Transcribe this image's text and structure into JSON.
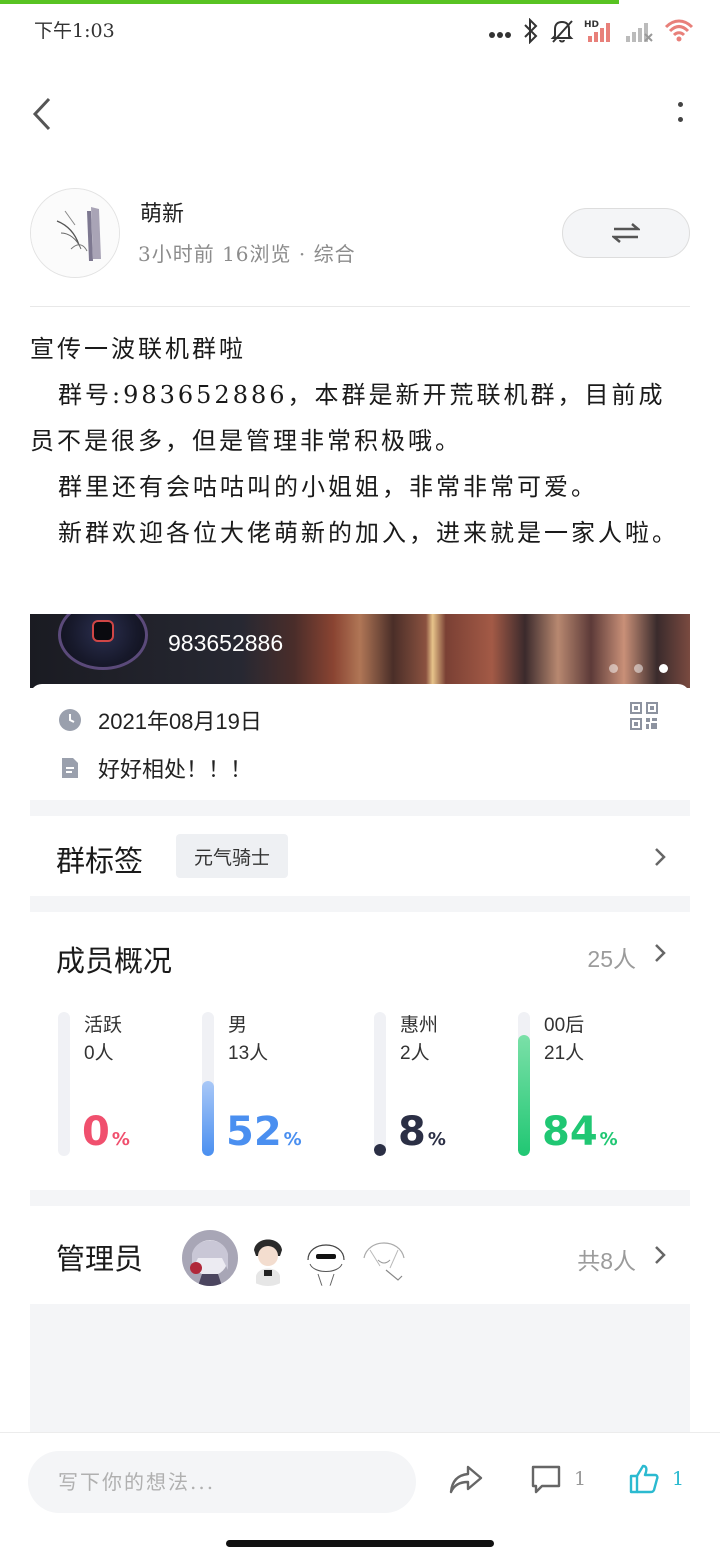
{
  "status_bar": {
    "time": "下午1:03",
    "icons": [
      "more-dots-icon",
      "bluetooth-icon",
      "mute-bell-icon",
      "hd-signal-icon",
      "no-signal-icon",
      "wifi-icon"
    ],
    "page_load_progress": 0.86
  },
  "author": {
    "name": "萌新",
    "meta": "3小时前  16浏览  ·  综合"
  },
  "post": {
    "paragraphs": [
      "宣传一波联机群啦",
      "群号:983652886，本群是新开荒联机群，目前成员不是很多，但是管理非常积极哦。",
      "群里还有会咕咕叫的小姐姐，非常非常可爱。",
      "新群欢迎各位大佬萌新的加入，进来就是一家人啦。"
    ]
  },
  "group_card": {
    "group_number": "983652886",
    "date": "2021年08月19日",
    "description": "好好相处！！！",
    "carousel_pages": 3,
    "carousel_active": 3
  },
  "tags_section": {
    "title": "群标签",
    "tag": "元气骑士"
  },
  "members_section": {
    "title": "成员概况",
    "total": "25人",
    "stats": [
      {
        "label": "活跃",
        "count": "0人",
        "percent": 0,
        "percent_text": "0",
        "color": "#f0506e"
      },
      {
        "label": "男",
        "count": "13人",
        "percent": 52,
        "percent_text": "52",
        "color": "#4a8ff0"
      },
      {
        "label": "惠州",
        "count": "2人",
        "percent": 8,
        "percent_text": "8",
        "color": "#2b2f45"
      },
      {
        "label": "00后",
        "count": "21人",
        "percent": 84,
        "percent_text": "84",
        "color": "#20c773"
      }
    ],
    "percent_unit": "%"
  },
  "admins_section": {
    "title": "管理员",
    "total": "共8人"
  },
  "bottom_bar": {
    "comment_placeholder": "写下你的想法...",
    "comment_count": "1",
    "like_count": "1",
    "like_color": "#2bbad0"
  }
}
